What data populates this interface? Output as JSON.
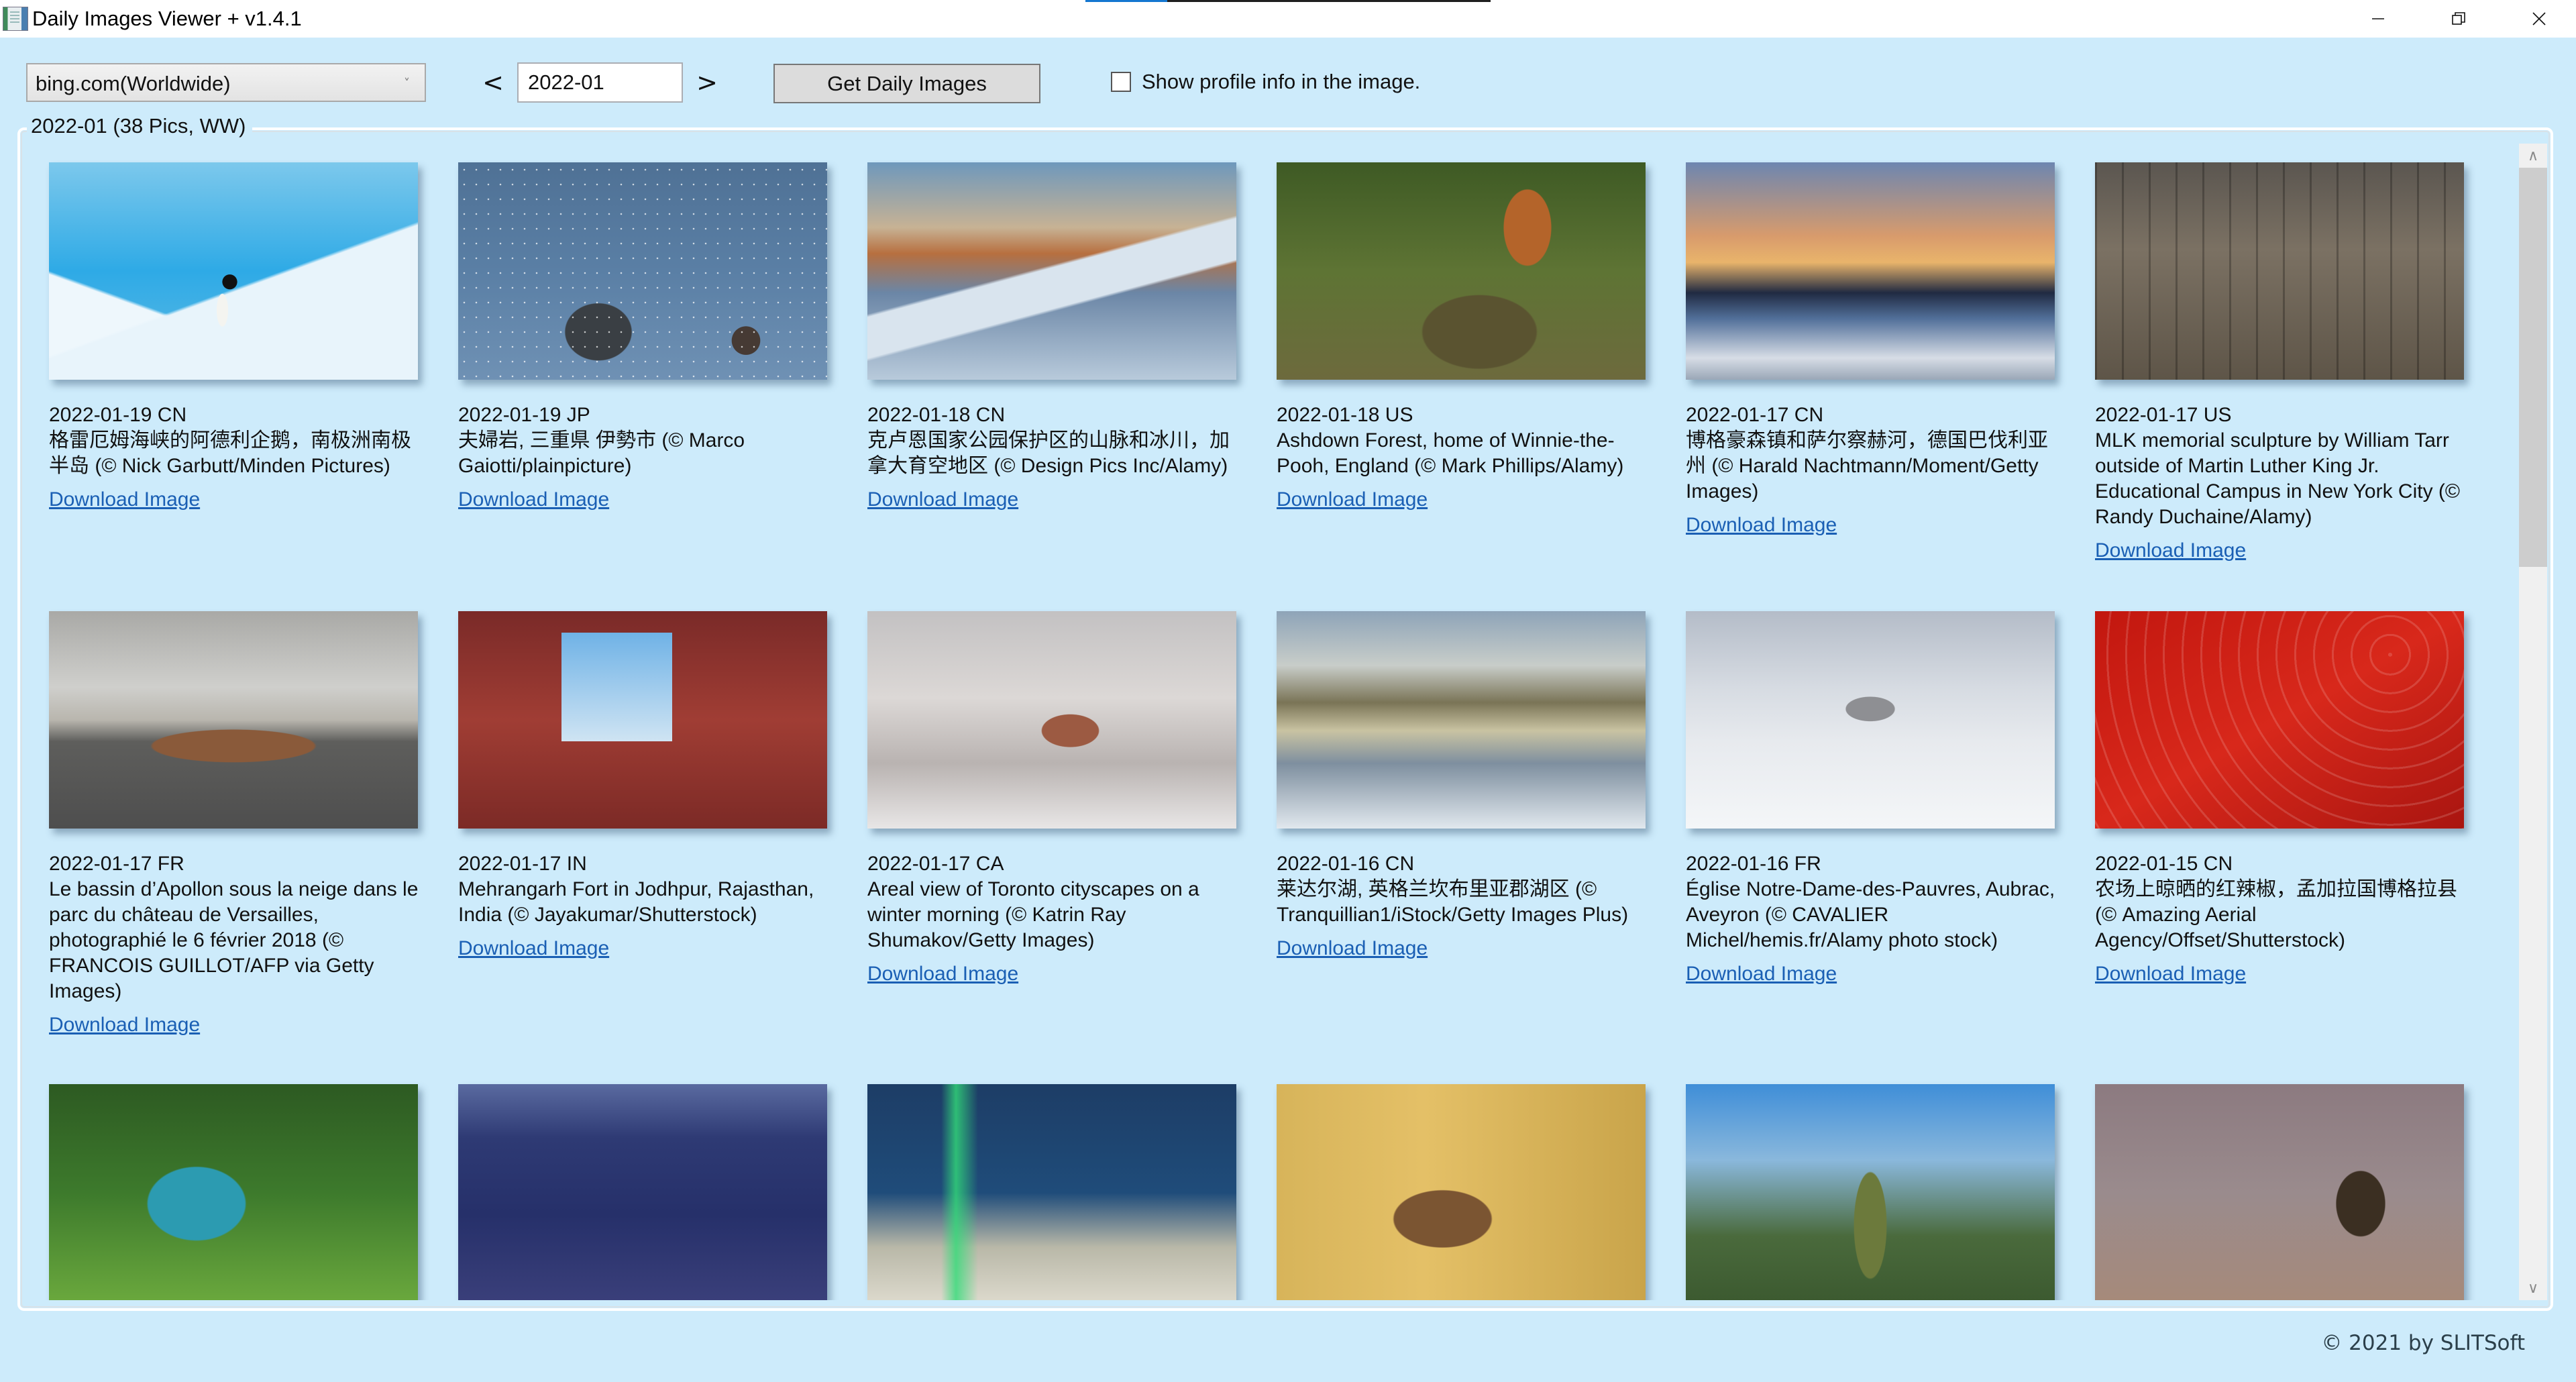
{
  "window": {
    "title": "Daily Images Viewer + v1.4.1",
    "controls": {
      "minimize_icon": "minimize-icon",
      "restore_icon": "restore-icon",
      "close_icon": "close-icon"
    }
  },
  "toolbar": {
    "source_select": {
      "selected": "bing.com(Worldwide)",
      "chevron": "˅"
    },
    "prev_label": "<",
    "next_label": ">",
    "month_value": "2022-01",
    "get_button_label": "Get Daily Images",
    "profile_checkbox": {
      "label": "Show profile info in the image.",
      "checked": false
    }
  },
  "gallery": {
    "legend": "2022-01 (38 Pics, WW)",
    "download_label": "Download Image",
    "items": [
      {
        "date": "2022-01-19 CN",
        "desc": "格雷厄姆海峡的阿德利企鹅，南极洲南极半岛 (© Nick Garbutt/Minden Pictures)",
        "art": "penguin"
      },
      {
        "date": "2022-01-19 JP",
        "desc": "夫婦岩, 三重県 伊勢市 (© Marco Gaiotti/plainpicture)",
        "art": "rocks"
      },
      {
        "date": "2022-01-18 CN",
        "desc": "克卢恩国家公园保护区的山脉和冰川，加拿大育空地区 (© Design Pics Inc/Alamy)",
        "art": "glacier"
      },
      {
        "date": "2022-01-18 US",
        "desc": "Ashdown Forest, home of Winnie-the-Pooh, England (© Mark Phillips/Alamy)",
        "art": "forest"
      },
      {
        "date": "2022-01-17 CN",
        "desc": "博格豪森镇和萨尔察赫河，德国巴伐利亚州 (© Harald Nachtmann/Moment/Getty Images)",
        "art": "town"
      },
      {
        "date": "2022-01-17 US",
        "desc": "MLK memorial sculpture by William Tarr outside of Martin Luther King Jr. Educational Campus in New York City (© Randy Duchaine/Alamy)",
        "art": "mlk"
      },
      {
        "date": "2022-01-17 FR",
        "desc": "Le bassin d’Apollon sous la neige dans le parc du château de Versailles, photographié le 6 février 2018 (© FRANCOIS GUILLOT/AFP via Getty Images)",
        "art": "versailles"
      },
      {
        "date": "2022-01-17 IN",
        "desc": "Mehrangarh Fort in Jodhpur, Rajasthan, India (© Jayakumar/Shutterstock)",
        "art": "fort"
      },
      {
        "date": "2022-01-17 CA",
        "desc": "Areal view of Toronto cityscapes on a winter morning (© Katrin Ray Shumakov/Getty Images)",
        "art": "toronto"
      },
      {
        "date": "2022-01-16 CN",
        "desc": "莱达尔湖, 英格兰坎布里亚郡湖区 (© Tranquillian1/iStock/Getty Images Plus)",
        "art": "lake"
      },
      {
        "date": "2022-01-16 FR",
        "desc": "Église Notre-Dame-des-Pauvres, Aubrac, Aveyron (© CAVALIER Michel/hemis.fr/Alamy photo stock)",
        "art": "church"
      },
      {
        "date": "2022-01-15 CN",
        "desc": "农场上晾晒的红辣椒，孟加拉国博格拉县 (© Amazing Aerial Agency/Offset/Shutterstock)",
        "art": "peppers"
      },
      {
        "date": "",
        "desc": "",
        "art": "cave"
      },
      {
        "date": "",
        "desc": "",
        "art": "road"
      },
      {
        "date": "",
        "desc": "",
        "art": "aurora"
      },
      {
        "date": "",
        "desc": "",
        "art": "drum"
      },
      {
        "date": "",
        "desc": "",
        "art": "peak"
      },
      {
        "date": "",
        "desc": "",
        "art": "porcupine"
      }
    ]
  },
  "scrollbar": {
    "up_icon": "∧",
    "down_icon": "∨",
    "position_fraction": 0.0,
    "visible_fraction": 0.36
  },
  "footer": {
    "copyright": "© 2021 by SLITSoft"
  }
}
